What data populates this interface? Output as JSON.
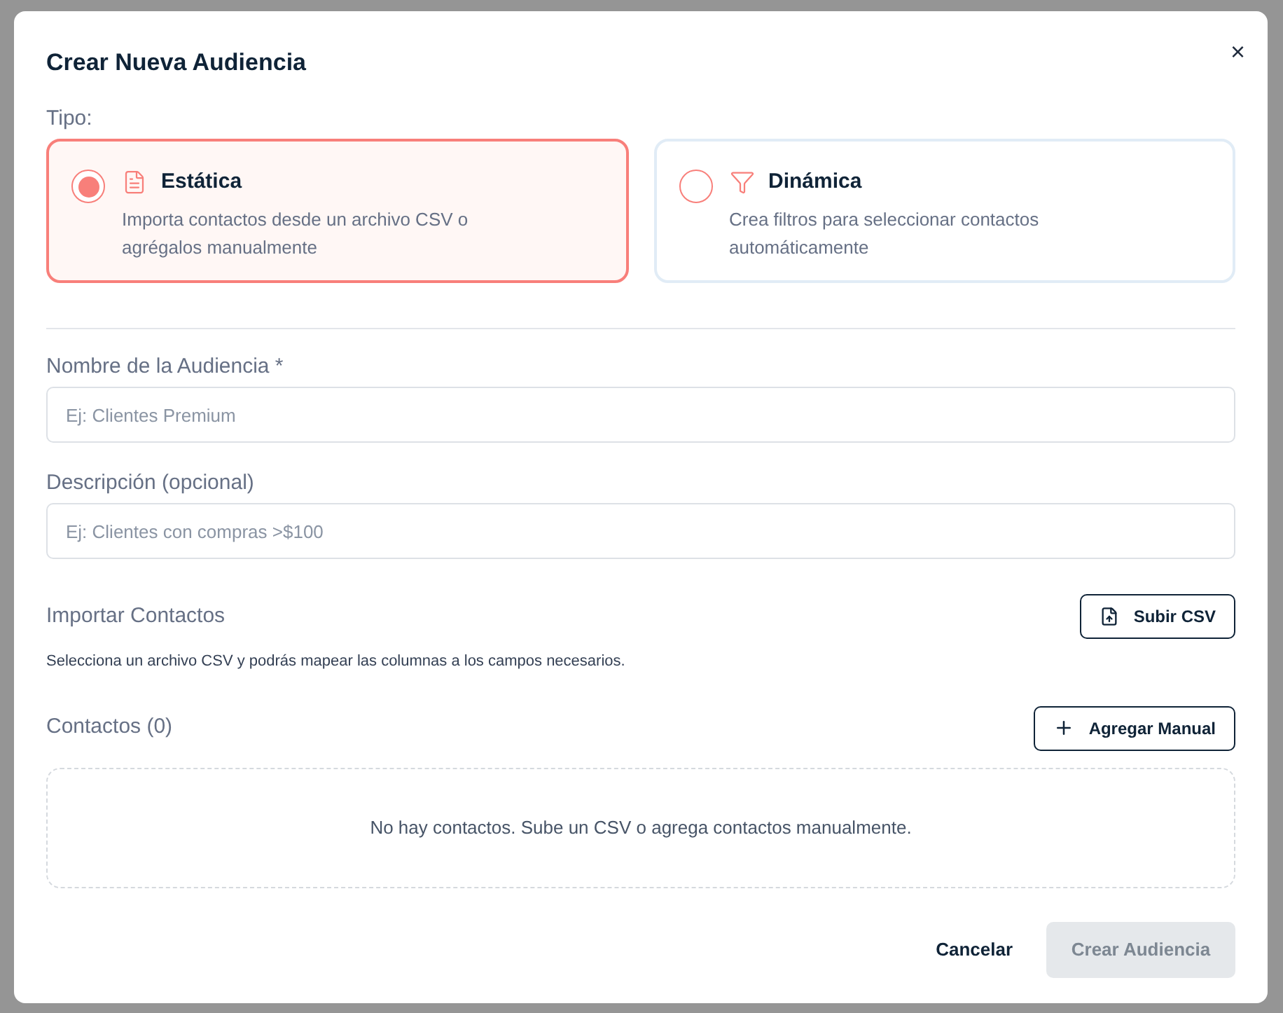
{
  "dialog": {
    "title": "Crear Nueva Audiencia",
    "close": "×",
    "type_label": "Tipo:",
    "types": [
      {
        "kind": "file",
        "title": "Estática",
        "description": "Importa contactos desde un archivo CSV o agrégalos manualmente",
        "selected": true
      },
      {
        "kind": "filter",
        "title": "Dinámica",
        "description": "Crea filtros para seleccionar contactos automáticamente",
        "selected": false
      }
    ],
    "fields": [
      {
        "label": "Nombre de la Audiencia *",
        "placeholder": "Ej: Clientes Premium"
      },
      {
        "label": "Descripción (opcional)",
        "placeholder": "Ej: Clientes con compras >$100"
      }
    ],
    "import": {
      "label": "Importar Contactos",
      "button": "Subir CSV",
      "help": "Selecciona un archivo CSV y podrás mapear las columnas a los campos necesarios."
    },
    "contacts": {
      "label": "Contactos (0)",
      "button": "Agregar Manual",
      "empty": "No hay contactos. Sube un CSV o agrega contactos manualmente."
    },
    "footer": {
      "cancel": "Cancelar",
      "submit": {
        "label": "Crear Audiencia",
        "disabled": true
      }
    }
  }
}
